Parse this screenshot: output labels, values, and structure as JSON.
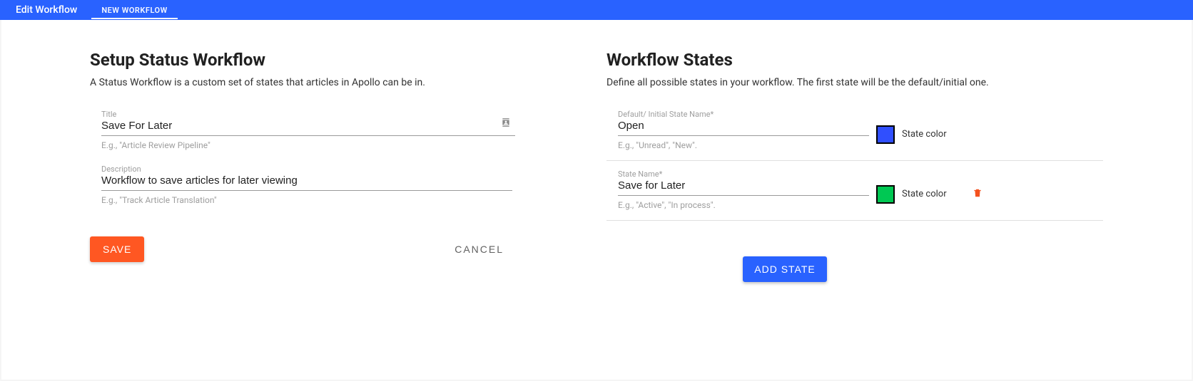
{
  "tabs": {
    "active": "Edit Workflow",
    "inactive": "NEW WORKFLOW"
  },
  "left": {
    "heading": "Setup Status Workflow",
    "subtitle": "A Status Workflow is a custom set of states that articles in Apollo can be in.",
    "title_label": "Title",
    "title_value": "Save For Later",
    "title_helper": "E.g., \"Article Review Pipeline\"",
    "desc_label": "Description",
    "desc_value": "Workflow to save articles for later viewing",
    "desc_helper": "E.g., \"Track Article Translation\"",
    "save_btn": "SAVE",
    "cancel_btn": "CANCEL"
  },
  "right": {
    "heading": "Workflow States",
    "subtitle": "Define all possible states in your workflow. The first state will be the default/initial one.",
    "add_state_btn": "ADD STATE",
    "color_label": "State color",
    "states": [
      {
        "label": "Default/ Initial State Name*",
        "value": "Open",
        "helper": "E.g., \"Unread\", \"New\".",
        "color": "#304ffe",
        "deletable": false
      },
      {
        "label": "State Name*",
        "value": "Save for Later",
        "helper": "E.g., \"Active\", \"In process\".",
        "color": "#00c853",
        "deletable": true
      }
    ]
  }
}
